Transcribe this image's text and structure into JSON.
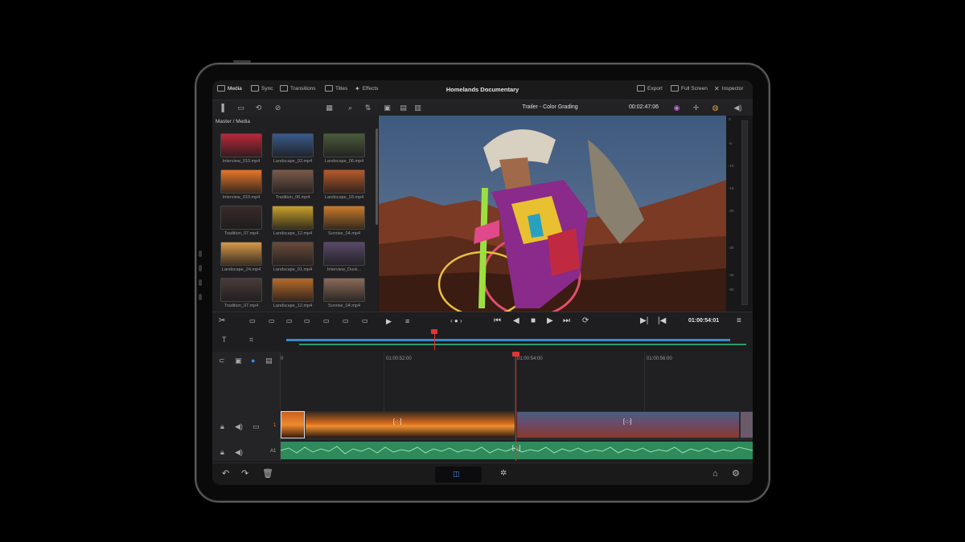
{
  "app": {
    "title": "Homelands Documentary"
  },
  "topbar": {
    "left": [
      {
        "id": "media",
        "label": "Media",
        "icon": "media-icon"
      },
      {
        "id": "sync",
        "label": "Sync",
        "icon": "sync-icon"
      },
      {
        "id": "transitions",
        "label": "Transitions",
        "icon": "transitions-icon"
      },
      {
        "id": "titles",
        "label": "Titles",
        "icon": "titles-icon"
      },
      {
        "id": "effects",
        "label": "Effects",
        "icon": "effects-icon"
      }
    ],
    "right": [
      {
        "id": "export",
        "label": "Export",
        "icon": "export-icon"
      },
      {
        "id": "fullscreen",
        "label": "Full Screen",
        "icon": "fullscreen-icon"
      },
      {
        "id": "inspector",
        "label": "Inspector",
        "icon": "inspector-icon"
      }
    ]
  },
  "viewer": {
    "timeline_name": "Trailer - Color Grading",
    "source_timecode": "00:02:47:06",
    "record_timecode": "01:00:54:01"
  },
  "media_pool": {
    "breadcrumb": "Master / Media",
    "clips": [
      {
        "label": "Interview_010.mp4",
        "color": "#b8283a"
      },
      {
        "label": "Landscape_02.mp4",
        "color": "#3a5a8a"
      },
      {
        "label": "Landscape_06.mp4",
        "color": "#4a5a3a"
      },
      {
        "label": "Interview_010.mp4",
        "color": "#e8762a"
      },
      {
        "label": "Tradition_06.mp4",
        "color": "#7a5a4a"
      },
      {
        "label": "Landscape_03.mp4",
        "color": "#b85a2a"
      },
      {
        "label": "Tradition_07.mp4",
        "color": "#3a2a2a"
      },
      {
        "label": "Landscape_12.mp4",
        "color": "#c8a02a"
      },
      {
        "label": "Sunrise_04.mp4",
        "color": "#c87a2a"
      },
      {
        "label": "Landscape_24.mp4",
        "color": "#d89a4a"
      },
      {
        "label": "Landscape_01.mp4",
        "color": "#6a4a3a"
      },
      {
        "label": "Interview_Dusk...",
        "color": "#5a4a6a"
      },
      {
        "label": "Tradition_07.mp4",
        "color": "#4a3a3a"
      },
      {
        "label": "Landscape_12.mp4",
        "color": "#b86a2a"
      },
      {
        "label": "Sunrise_04.mp4",
        "color": "#8a6a5a"
      }
    ]
  },
  "timeline": {
    "ruler": [
      "01:00:52:00",
      "01:00:54:00",
      "01:00:56:00"
    ],
    "ruler_start": "0",
    "tracks": {
      "video": "1",
      "audio": "A1"
    }
  },
  "meter_ticks": [
    "0",
    "-5",
    "-10",
    "-15",
    "-20",
    "-30",
    "-40",
    "-50"
  ],
  "colors": {
    "playhead": "#e03535",
    "audio_track": "#2f8a5c",
    "overview_video": "#3a8ac8",
    "overview_audio": "#2f9a6a"
  }
}
